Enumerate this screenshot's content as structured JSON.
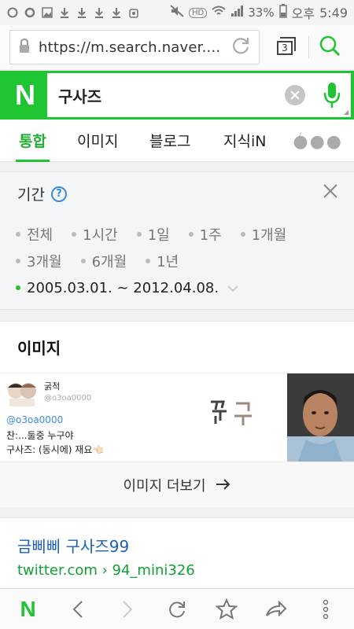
{
  "status_bar": {
    "battery": "33%",
    "ampm": "오후",
    "time": "5:49",
    "hd_label": "HD"
  },
  "url_bar": {
    "url": "https://m.search.naver....",
    "tab_count": "3"
  },
  "search": {
    "logo": "N",
    "query": "구사즈"
  },
  "tabs": [
    {
      "label": "통합",
      "active": true
    },
    {
      "label": "이미지",
      "active": false
    },
    {
      "label": "블로그",
      "active": false
    },
    {
      "label": "지식iN",
      "active": false
    }
  ],
  "period": {
    "title": "기간",
    "options_row1": [
      "전체",
      "1시간",
      "1일",
      "1주",
      "1개월"
    ],
    "options_row2": [
      "3개월",
      "6개월",
      "1년"
    ],
    "selected_range": "2005.03.01. ~ 2012.04.08."
  },
  "images": {
    "title": "이미지",
    "tweet": {
      "name": "굵적",
      "handle": "@o3oa0000",
      "mention": "@o3oa0000",
      "line1": "찬:...둘중 누구야",
      "line2": "구사즈: (동시에) 재요👈🏻"
    },
    "more_label": "이미지 더보기"
  },
  "result": {
    "title": "금삐삐 구사즈99",
    "url": "twitter.com › 94_mini326"
  },
  "colors": {
    "brand_green": "#1fc433",
    "link_blue": "#1a5fb8",
    "url_green": "#11a033"
  }
}
